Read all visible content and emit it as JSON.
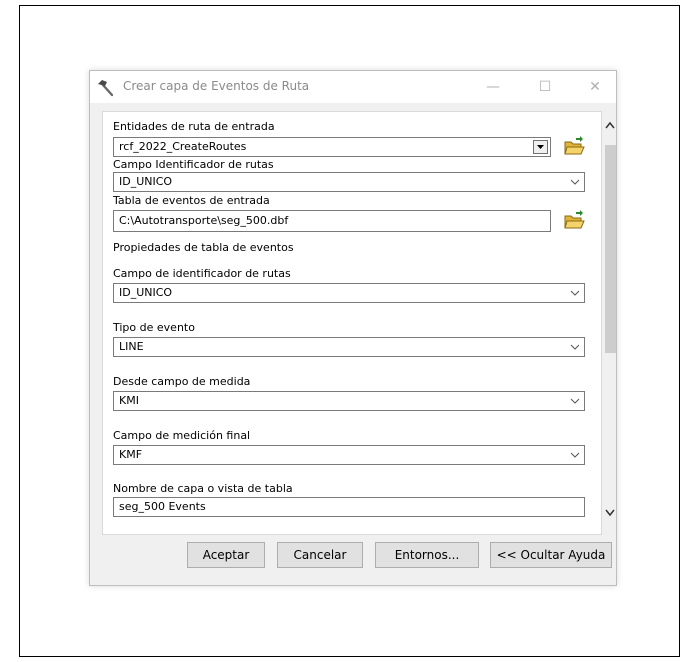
{
  "window": {
    "title": "Crear capa de Eventos de Ruta",
    "minimize": "—",
    "maximize": "☐",
    "close": "✕"
  },
  "fields": {
    "input_routes_label": "Entidades de ruta de entrada",
    "input_routes_value": "rcf_2022_CreateRoutes",
    "route_id_field_label": "Campo Identificador de rutas",
    "route_id_field_value": "ID_UNICO",
    "event_table_label": "Tabla de eventos de entrada",
    "event_table_value": "C:\\Autotransporte\\seg_500.dbf",
    "event_props_label": "Propiedades de tabla de eventos",
    "event_route_id_label": "Campo de identificador de rutas",
    "event_route_id_value": "ID_UNICO",
    "event_type_label": "Tipo de evento",
    "event_type_value": "LINE",
    "from_measure_label": "Desde campo de medida",
    "from_measure_value": "KMI",
    "to_measure_label": "Campo de medición final",
    "to_measure_value": "KMF",
    "layer_name_label": "Nombre de capa o vista de tabla",
    "layer_name_value": "seg_500 Events"
  },
  "buttons": {
    "ok": "Aceptar",
    "cancel": "Cancelar",
    "environments": "Entornos...",
    "hide_help": "<< Ocultar Ayuda"
  },
  "colors": {
    "folder": "#f2c84b",
    "scroll_thumb": "#cdcdcd"
  }
}
